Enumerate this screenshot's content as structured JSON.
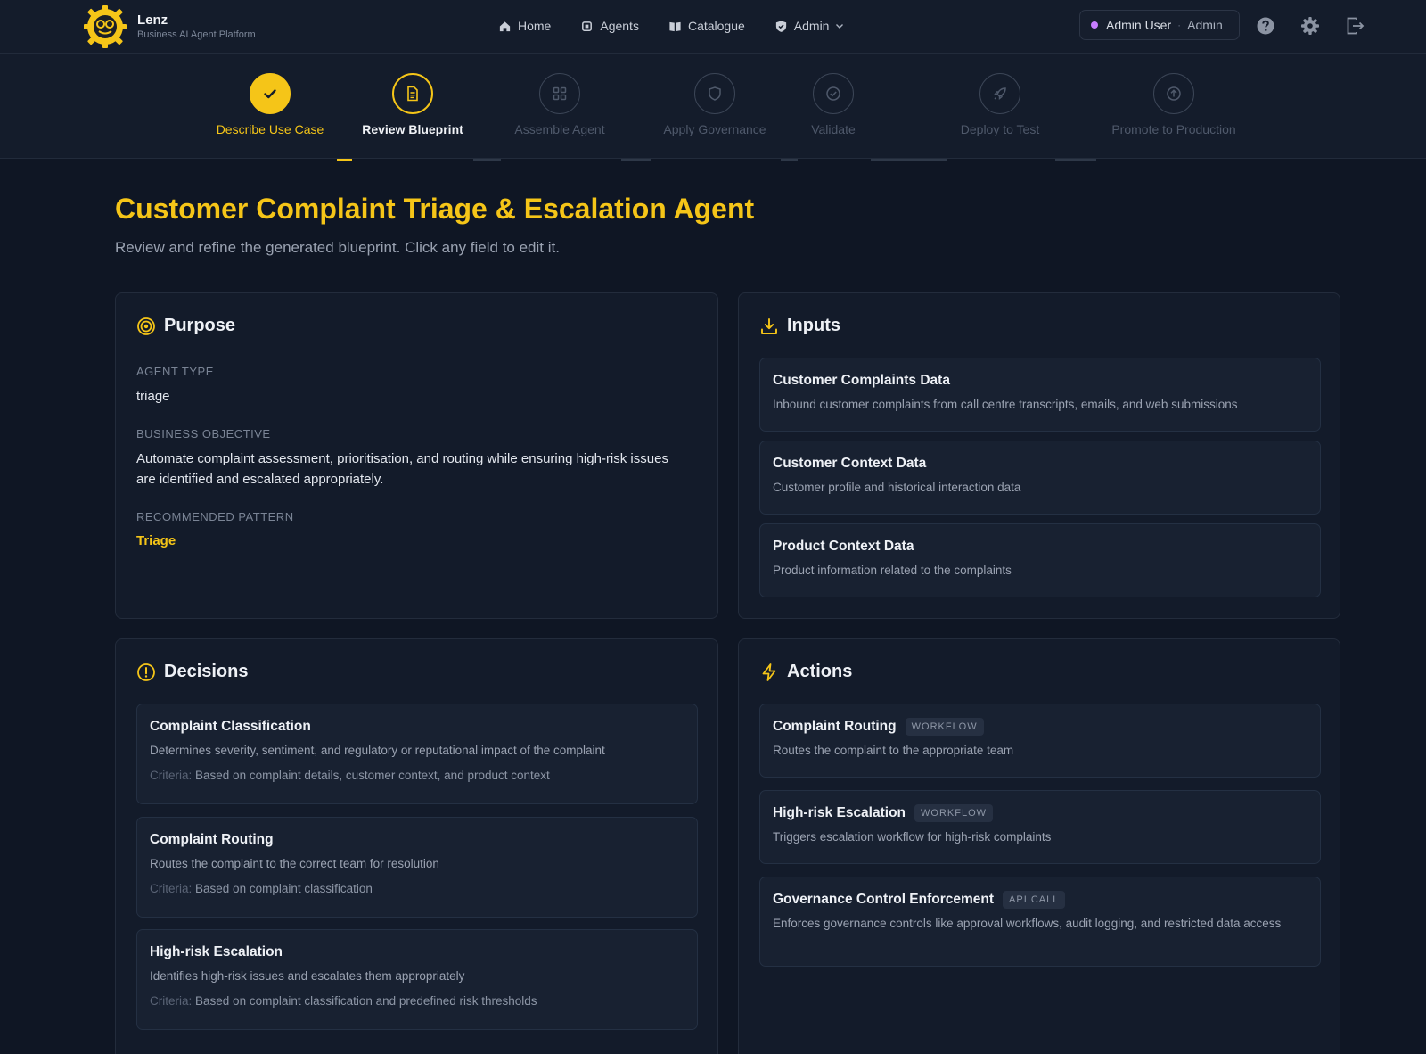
{
  "app": {
    "name": "Lenz",
    "subtitle": "Business AI Agent Platform"
  },
  "nav": {
    "links": [
      {
        "label": "Home",
        "icon": "home-icon"
      },
      {
        "label": "Agents",
        "icon": "chip-icon"
      },
      {
        "label": "Catalogue",
        "icon": "book-icon"
      },
      {
        "label": "Admin",
        "icon": "shield-icon"
      }
    ],
    "user": {
      "name": "Admin User",
      "role": "Admin"
    }
  },
  "stepper": {
    "steps": [
      {
        "label": "Describe Use Case",
        "state": "done",
        "icon": "check-icon"
      },
      {
        "label": "Review Blueprint",
        "state": "current",
        "icon": "document-icon"
      },
      {
        "label": "Assemble Agent",
        "state": "pending",
        "icon": "grid-icon"
      },
      {
        "label": "Apply Governance",
        "state": "pending",
        "icon": "shield-icon"
      },
      {
        "label": "Validate",
        "state": "pending",
        "icon": "check-circle-icon"
      },
      {
        "label": "Deploy to Test",
        "state": "pending",
        "icon": "rocket-icon"
      },
      {
        "label": "Promote to Production",
        "state": "pending",
        "icon": "arrow-up-circle-icon"
      }
    ]
  },
  "page": {
    "title": "Customer Complaint Triage & Escalation Agent",
    "subtitle": "Review and refine the generated blueprint. Click any field to edit it."
  },
  "purpose": {
    "title": "Purpose",
    "agent_type_label": "Agent Type",
    "agent_type": "triage",
    "objective_label": "Business Objective",
    "objective": "Automate complaint assessment, prioritisation, and routing while ensuring high-risk issues are identified and escalated appropriately.",
    "pattern_label": "Recommended Pattern",
    "pattern": "Triage"
  },
  "inputs": {
    "title": "Inputs",
    "items": [
      {
        "title": "Customer Complaints Data",
        "desc": "Inbound customer complaints from call centre transcripts, emails, and web submissions"
      },
      {
        "title": "Customer Context Data",
        "desc": "Customer profile and historical interaction data"
      },
      {
        "title": "Product Context Data",
        "desc": "Product information related to the complaints"
      }
    ]
  },
  "decisions": {
    "title": "Decisions",
    "criteria_label": "Criteria:",
    "items": [
      {
        "title": "Complaint Classification",
        "desc": "Determines severity, sentiment, and regulatory or reputational impact of the complaint",
        "criteria": "Based on complaint details, customer context, and product context"
      },
      {
        "title": "Complaint Routing",
        "desc": "Routes the complaint to the correct team for resolution",
        "criteria": "Based on complaint classification"
      },
      {
        "title": "High-risk Escalation",
        "desc": "Identifies high-risk issues and escalates them appropriately",
        "criteria": "Based on complaint classification and predefined risk thresholds"
      }
    ]
  },
  "actions": {
    "title": "Actions",
    "items": [
      {
        "title": "Complaint Routing",
        "badge": "WORKFLOW",
        "desc": "Routes the complaint to the appropriate team"
      },
      {
        "title": "High-risk Escalation",
        "badge": "WORKFLOW",
        "desc": "Triggers escalation workflow for high-risk complaints"
      },
      {
        "title": "Governance Control Enforcement",
        "badge": "API CALL",
        "desc": "Enforces governance controls like approval workflows, audit logging, and restricted data access"
      }
    ]
  },
  "colors": {
    "accent": "#f5c518",
    "background": "#0f1624",
    "card": "#131b2a",
    "user_dot": "#c77dff"
  }
}
